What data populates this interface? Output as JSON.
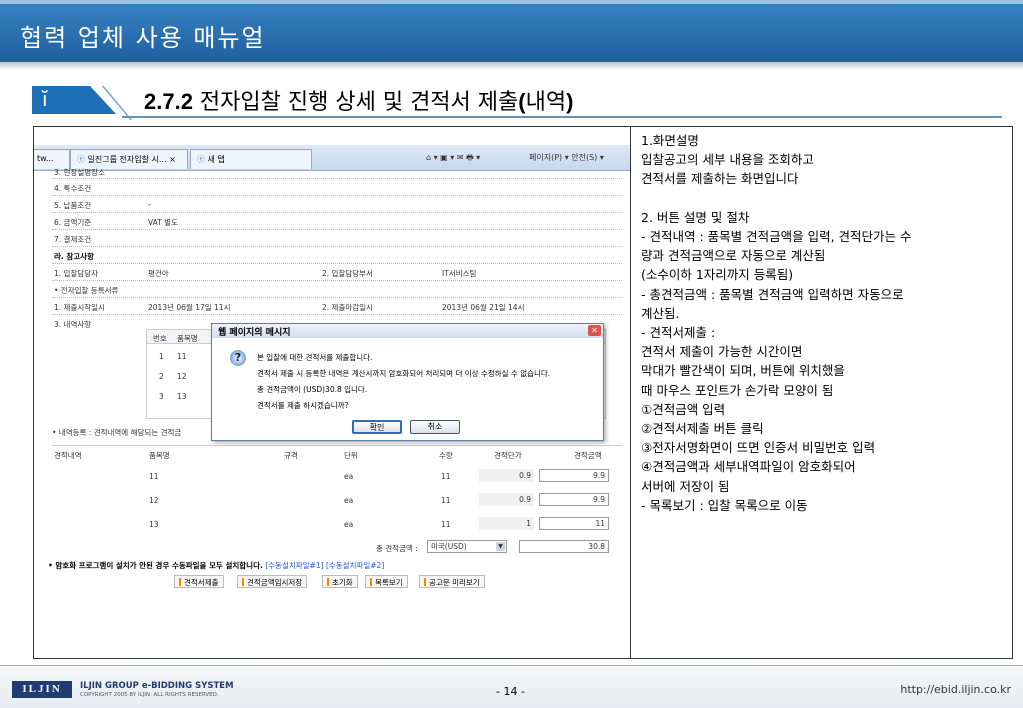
{
  "header": {
    "title": "협력 업체 사용 매뉴얼"
  },
  "section": {
    "icon": "info-icon",
    "number": "2.7.2",
    "title_main": " 전자입찰 진행 상세 및 견적서 제출",
    "title_paren": "(",
    "title_bold": "내역",
    "title_close": ")"
  },
  "browser": {
    "tab1": "tw...",
    "tab2": "일진그룹 전자입찰 시...",
    "tab2_close": "×",
    "tab3": "새 탭",
    "toolbar": "페이지(P) ▾  안전(S) ▾"
  },
  "grid_rows": [
    {
      "label": "3. 현장설명장소",
      "value": ""
    },
    {
      "label": "4. 특수조건",
      "value": ""
    },
    {
      "label": "5. 납품조건",
      "value": "-"
    },
    {
      "label": "6. 금액기준",
      "value": "VAT 별도"
    },
    {
      "label": "7. 결제조건",
      "value": ""
    },
    {
      "label": "라. 참고사항",
      "value": ""
    },
    {
      "label": "1. 입찰담당자",
      "value": "평건아",
      "label2": "2. 입찰담당부서",
      "value2": "IT서비스팀"
    },
    {
      "label": "• 전자입찰 등록서류",
      "value": ""
    },
    {
      "label": "1. 제출시작일시",
      "value": "2013년 06월 17일 11시",
      "label2": "2. 제출마감일시",
      "value2": "2013년 06월 21일 14시"
    },
    {
      "label": "3. 내역사항",
      "value": ""
    }
  ],
  "item_table": {
    "headers": [
      "번호",
      "품목명"
    ],
    "rows": [
      [
        "1",
        "11"
      ],
      [
        "2",
        "12"
      ],
      [
        "3",
        "13"
      ]
    ]
  },
  "dialog": {
    "title": "웹 페이지의 메시지",
    "close": "✕",
    "icon": "question-icon",
    "lines": [
      "본 입찰에 대한 견적서를 제출합니다.",
      "견적서 제출 시 등록한 내역은 계산시까지 암호화되어 처리되며 더 이상 수정하실 수 없습니다.",
      "총 견적금액이 (USD)30.8 입니다.",
      "견적서를 제출 하시겠습니까?"
    ],
    "ok": "확인",
    "cancel": "취소"
  },
  "quote": {
    "section_label": "• 내역등록 : 견적내역에 해당되는 견적금",
    "row_label": "견적내역",
    "headers": [
      "품목명",
      "규격",
      "단위",
      "수량",
      "견적단가",
      "견적금액"
    ],
    "rows": [
      [
        "11",
        "",
        "ea",
        "11",
        "0.9",
        "9.9"
      ],
      [
        "12",
        "",
        "ea",
        "11",
        "0.9",
        "9.9"
      ],
      [
        "13",
        "",
        "ea",
        "11",
        "1",
        "11"
      ]
    ],
    "total_label": "총 견적금액 :",
    "currency": "미국(USD)",
    "total": "30.8"
  },
  "notice": {
    "text": "• 암호화 프로그램이 설치가 안된 경우 수동파일을 모두 설치합니다.",
    "link1": "[수동설치파일#1]",
    "link2": "[수동설치파일#2]"
  },
  "buttons": [
    "견적서제출",
    "견적금액임시저장",
    "초기화",
    "목록보기",
    "공고문 미리보기"
  ],
  "description": [
    "1.화면설명",
    "  입찰공고의 세부 내용을 조회하고",
    "  견적서를 제출하는 화면입니다",
    "",
    "2. 버튼 설명 및 절차",
    "- 견적내역 : 품목별 견적금액을 입력, 견적단가는 수",
    "  량과 견적금액으로 자동으로 계산됨",
    "  (소수이하 1자리까지 등록됨)",
    "- 총견적금액 : 품목별 견적금액 입력하면 자동으로",
    "  계산됨.",
    "- 견적서제출 :",
    "    견적서 제출이 가능한 시간이면",
    "    막대가 빨간색이 되며, 버튼에 위치했을",
    "    때 마우스 포인트가 손가락 모양이 됨",
    "     ①견적금액 입력",
    "     ②견적서제출 버튼 클릭",
    "     ③전자서명화면이 뜨면 인증서 비밀번호 입력",
    "     ④견적금액과 세부내역파일이 암호화되어",
    "       서버에 저장이 됨",
    "- 목록보기 : 입찰 목록으로 이동"
  ],
  "footer": {
    "logo": "ILJIN",
    "company": "ILJIN GROUP e-BIDDING SYSTEM",
    "copyright": "COPYRIGHT 2005 BY ILJIN. ALL RIGHTS RESERVED.",
    "page": "- 14 -",
    "url": "http://ebid.iljin.co.kr"
  },
  "colors": {
    "header": "#1f5f9e",
    "accent": "#1d6fb8",
    "button_mark": "#f08a00"
  }
}
